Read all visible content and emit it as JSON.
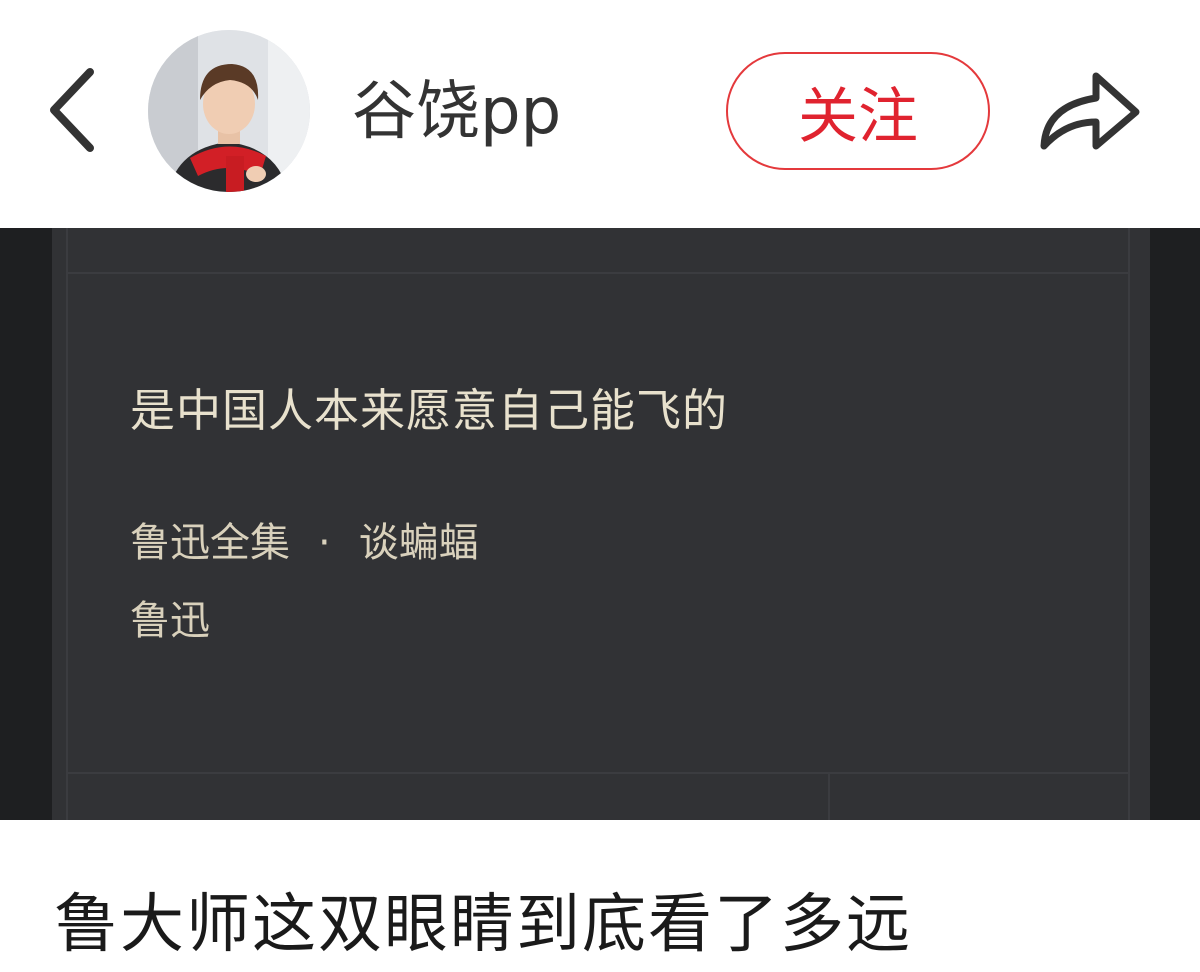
{
  "header": {
    "username": "谷饶pp",
    "follow_label": "关注"
  },
  "embed": {
    "quote": "是中国人本来愿意自己能飞的",
    "source_book": "鲁迅全集",
    "source_separator": "·",
    "source_chapter": "谈蝙蝠",
    "author": "鲁迅"
  },
  "post": {
    "title": "鲁大师这双眼睛到底看了多远"
  },
  "colors": {
    "accent": "#e0232f",
    "embed_bg": "#313235",
    "embed_text": "#e8e1cd"
  }
}
